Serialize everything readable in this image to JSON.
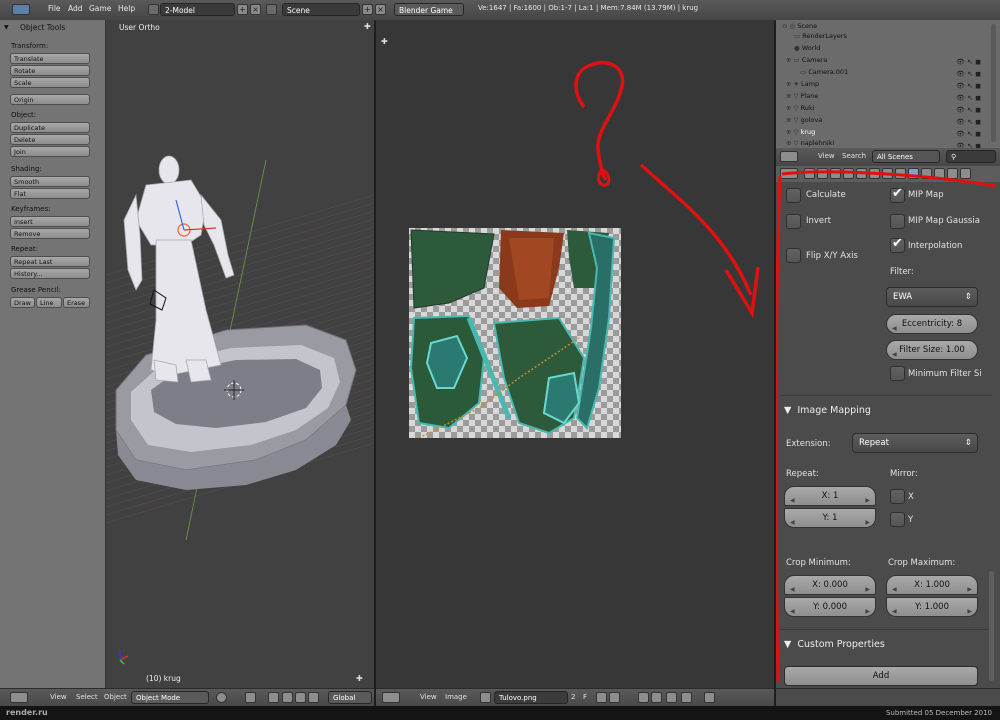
{
  "topbar": {
    "menus": [
      "File",
      "Add",
      "Game",
      "Help"
    ],
    "screen_layout": "2-Model",
    "scene": "Scene",
    "engine": "Blender Game",
    "stats": "Ve:1647 | Fa:1600 | Ob:1-7 | La:1 | Mem:7.84M (13.79M) | krug"
  },
  "toolshelf": {
    "title": "Object Tools",
    "transform_label": "Transform:",
    "translate": "Translate",
    "rotate": "Rotate",
    "scale": "Scale",
    "origin": "Origin",
    "object_label": "Object:",
    "duplicate": "Duplicate",
    "delete": "Delete",
    "join": "Join",
    "shading_label": "Shading:",
    "smooth": "Smooth",
    "flat": "Flat",
    "keyframes_label": "Keyframes:",
    "insert": "Insert",
    "remove": "Remove",
    "repeat_label": "Repeat:",
    "repeat_last": "Repeat Last",
    "history": "History...",
    "grease_label": "Grease Pencil:",
    "draw": "Draw",
    "line": "Line",
    "erase": "Erase"
  },
  "view3d": {
    "header": "User Ortho",
    "object_info": "(10) krug"
  },
  "outliner": {
    "rows": [
      "Scene",
      "RenderLayers",
      "World",
      "Camera",
      "Camera.001",
      "Lamp",
      "Plane",
      "Ruki",
      "golova",
      "krug",
      "naplehniki"
    ],
    "view": "View",
    "search": "Search",
    "filter": "All Scenes"
  },
  "props": {
    "calculate": "Calculate",
    "invert": "Invert",
    "flip_xy": "Flip X/Y Axis",
    "mip_map": "MIP Map",
    "mip_map_gaussian": "MIP Map Gaussia",
    "interpolation": "Interpolation",
    "filter_label": "Filter:",
    "filter_value": "EWA",
    "eccentricity": "Eccentricity: 8",
    "filter_size": "Filter Size: 1.00",
    "minimum_filter": "Minimum Filter Si",
    "image_mapping": "Image Mapping",
    "extension_label": "Extension:",
    "extension_value": "Repeat",
    "repeat_label": "Repeat:",
    "repeat_x": "X: 1",
    "repeat_y": "Y: 1",
    "mirror_label": "Mirror:",
    "mirror_x": "X",
    "mirror_y": "Y",
    "crop_min_label": "Crop Minimum:",
    "crop_min_x": "X: 0.000",
    "crop_min_y": "Y: 0.000",
    "crop_max_label": "Crop Maximum:",
    "crop_max_x": "X: 1.000",
    "crop_max_y": "Y: 1.000",
    "custom_properties": "Custom Properties",
    "add": "Add"
  },
  "bottom3d": {
    "view": "View",
    "select": "Select",
    "object": "Object",
    "mode": "Object Mode",
    "orientation": "Global"
  },
  "bottomimg": {
    "view": "View",
    "image": "Image",
    "image_name": "Tulovo.png",
    "users": "2",
    "fake": "F"
  },
  "footer": {
    "brand": "render.ru",
    "submitted": "Submitted 05 December 2010"
  },
  "annotation": {
    "mark": "?",
    "color": "#e01010"
  }
}
